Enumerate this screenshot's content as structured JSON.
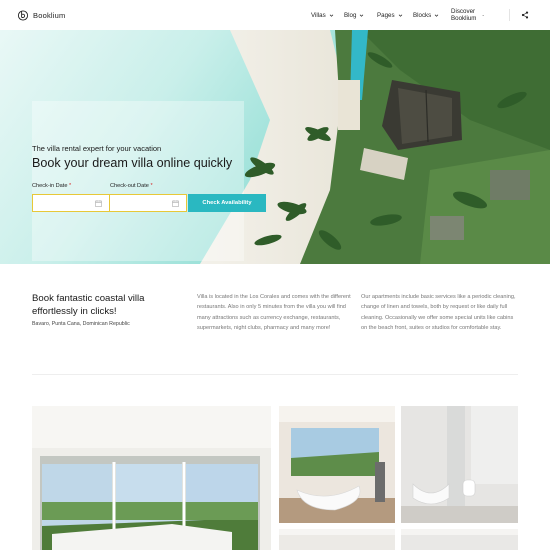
{
  "header": {
    "brand": "Booklium",
    "nav": [
      {
        "label": "Villas"
      },
      {
        "label": "Blog"
      },
      {
        "label": "Pages"
      },
      {
        "label": "Blocks"
      },
      {
        "label": "Discover Booklium"
      }
    ]
  },
  "hero": {
    "eyebrow": "The villa rental expert for your vacation",
    "title": "Book your dream villa online quickly",
    "checkin_label": "Check-in Date",
    "checkout_label": "Check-out Date",
    "required_mark": "*",
    "button_label": "Check Availability"
  },
  "info": {
    "title": "Book fantastic coastal villa effortlessly in clicks!",
    "location": "Bavaro, Punta Cana, Dominican Republic",
    "paragraph_1": "Villa is located in the Los Corales and comes with the different restaurants. Also in only 5 minutes from the villa you will find many attractions such as currency exchange, restaurants, supermarkets, night clubs, pharmacy and many more!",
    "paragraph_2": "Our apartments include basic services like a periodic cleaning, change of linen and towels, both by request or like daily full cleaning. Occasionally we offer some special units like cabins on the beach front, suites or studios for comfortable stay."
  },
  "colors": {
    "accent": "#2ab8c1",
    "field_border": "#e7c838",
    "required": "#d62b2b"
  },
  "icons": [
    "logo-icon",
    "chevron-down-icon",
    "share-icon",
    "calendar-icon"
  ]
}
